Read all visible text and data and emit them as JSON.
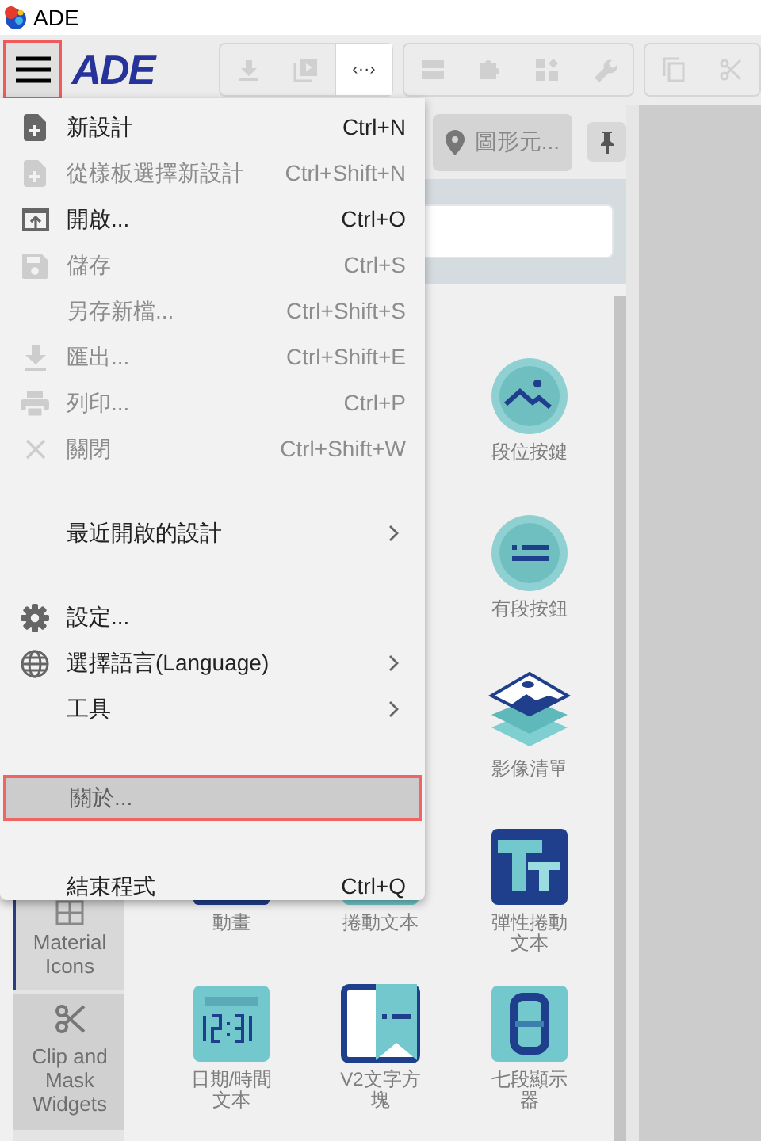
{
  "window": {
    "title": "ADE"
  },
  "toolbar": {
    "logo": "ADE",
    "code_button": "‹··›"
  },
  "panel": {
    "tab": "圖形元...",
    "tab_selected": true
  },
  "side_tabs": [
    {
      "label": "Material Icons",
      "selected": true
    },
    {
      "label": "Clip and Mask Widgets",
      "selected": false
    }
  ],
  "palette_rows": [
    {
      "items": [
        "段位按鍵"
      ]
    },
    {
      "items": [
        "有段按鈕"
      ]
    },
    {
      "items": [
        "影像清單"
      ]
    },
    {
      "items": [
        "動畫",
        "捲動文本",
        "彈性捲動文本"
      ]
    },
    {
      "items": [
        "日期/時間文本",
        "V2文字方塊",
        "七段顯示器"
      ]
    }
  ],
  "menu_sections": [
    {
      "items": [
        {
          "label": "新設計",
          "shortcut": "Ctrl+N",
          "disabled": false,
          "selected": false
        },
        {
          "label": "從樣板選擇新設計",
          "shortcut": "Ctrl+Shift+N",
          "disabled": true,
          "selected": false
        },
        {
          "label": "開啟...",
          "shortcut": "Ctrl+O",
          "disabled": false,
          "selected": false
        },
        {
          "label": "儲存",
          "shortcut": "Ctrl+S",
          "disabled": true,
          "selected": false
        },
        {
          "label": "另存新檔...",
          "shortcut": "Ctrl+Shift+S",
          "disabled": true,
          "selected": false
        },
        {
          "label": "匯出...",
          "shortcut": "Ctrl+Shift+E",
          "disabled": true,
          "selected": false
        },
        {
          "label": "列印...",
          "shortcut": "Ctrl+P",
          "disabled": true,
          "selected": false
        },
        {
          "label": "關閉",
          "shortcut": "Ctrl+Shift+W",
          "disabled": true,
          "selected": false
        }
      ]
    },
    {
      "items": [
        {
          "label": "最近開啟的設計",
          "submenu": true,
          "disabled": false,
          "selected": false
        }
      ]
    },
    {
      "items": [
        {
          "label": "設定...",
          "disabled": false,
          "selected": false
        },
        {
          "label": "選擇語言(Language)",
          "submenu": true,
          "disabled": false,
          "selected": false
        },
        {
          "label": "工具",
          "submenu": true,
          "disabled": false,
          "selected": false
        }
      ]
    },
    {
      "items": [
        {
          "label": "關於...",
          "disabled": false,
          "selected": true
        }
      ]
    },
    {
      "items": [
        {
          "label": "結束程式",
          "shortcut": "Ctrl+Q",
          "disabled": false,
          "selected": false
        }
      ]
    }
  ]
}
